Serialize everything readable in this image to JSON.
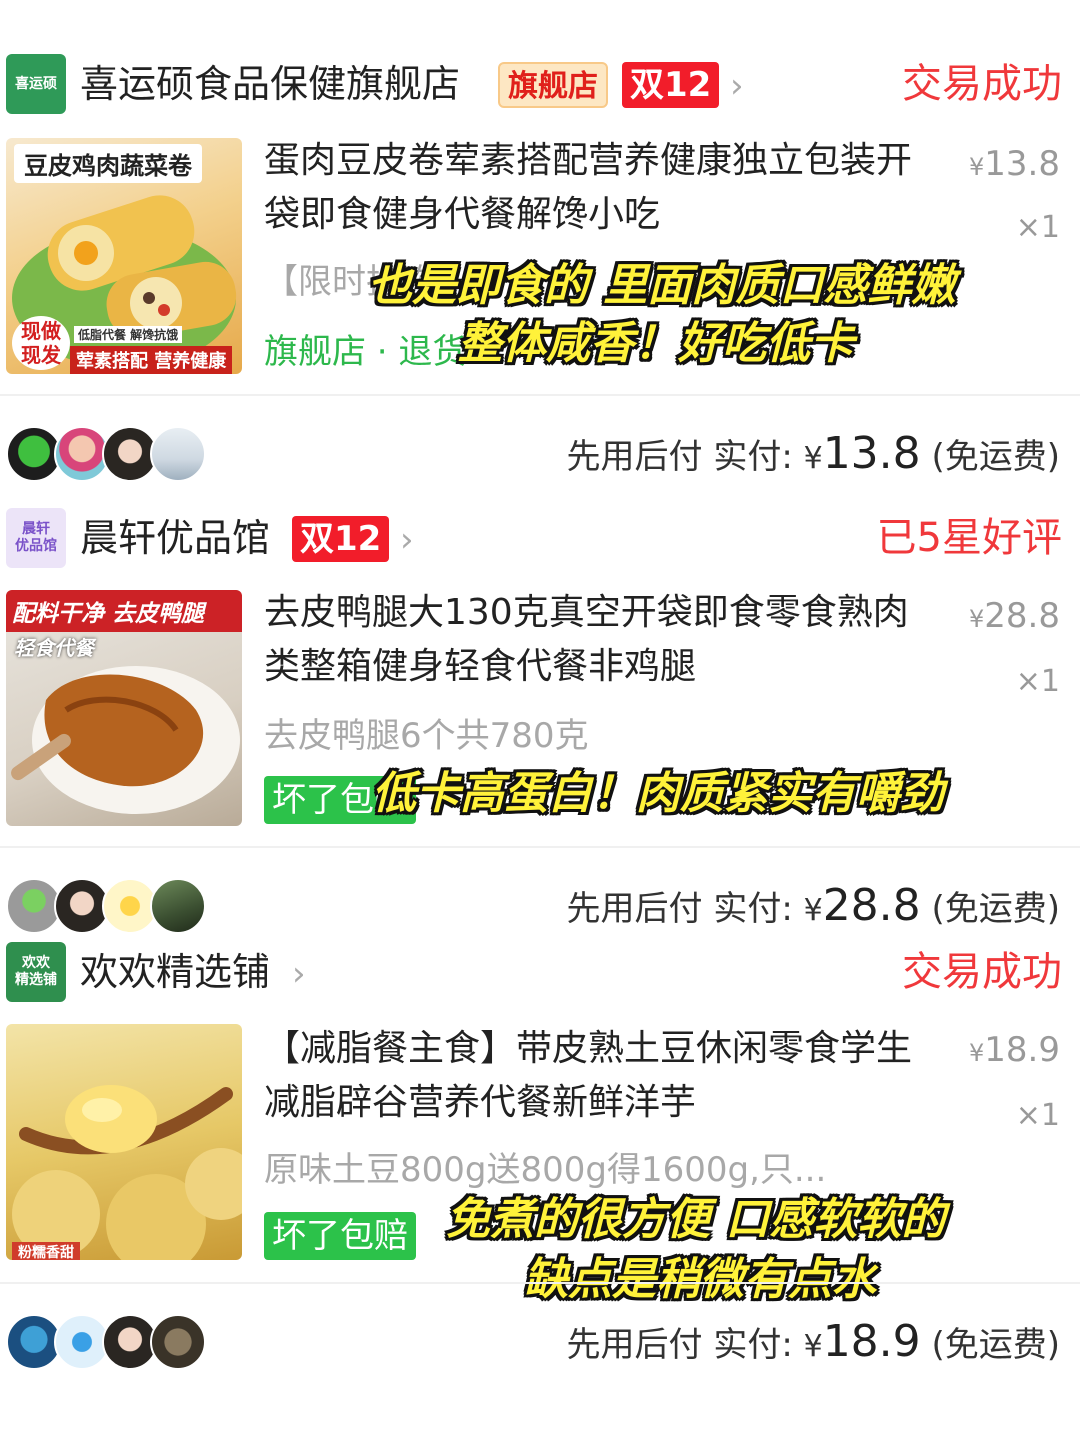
{
  "orders": [
    {
      "store": {
        "logo_text": "喜运硕",
        "name": "喜运硕食品保健旗舰店",
        "flag_badge": "旗舰店",
        "promo_badge": "双12"
      },
      "status": "交易成功",
      "product": {
        "thumb_title": "豆皮鸡肉蔬菜卷",
        "thumb_badge": "现做\n现发",
        "thumb_small": "低脂代餐 解馋抗饿",
        "thumb_caption": "荤素搭配 营养健康",
        "title": "蛋肉豆皮卷荤素搭配营养健康独立包装开袋即食健身代餐解馋小吃",
        "spec": "【限时抢购】",
        "price": "13.8",
        "qty": "×1",
        "tag": "旗舰店 · 退货"
      },
      "overlay": [
        "也是即食的 里面肉质口感鲜嫩",
        "整体咸香！好吃低卡"
      ],
      "pay": {
        "label": "先用后付 实付:",
        "currency": "¥",
        "amount": "13.8",
        "note": "(免运费)"
      }
    },
    {
      "store": {
        "logo_text": "晨轩\n优品馆",
        "name": "晨轩优品馆",
        "promo_badge": "双12"
      },
      "status": "已5星好评",
      "product": {
        "thumb_title": "配料干净 去皮鸭腿",
        "thumb_sub": "轻食代餐",
        "title": "去皮鸭腿大130克真空开袋即食零食熟肉类整箱健身轻食代餐非鸡腿",
        "spec": "去皮鸭腿6个共780克",
        "price": "28.8",
        "qty": "×1",
        "tag": "坏了包赔"
      },
      "overlay": [
        "低卡高蛋白！肉质紧实有嚼劲"
      ],
      "pay": {
        "label": "先用后付 实付:",
        "currency": "¥",
        "amount": "28.8",
        "note": "(免运费)"
      }
    },
    {
      "store": {
        "logo_text": "欢欢\n精选铺",
        "name": "欢欢精选铺"
      },
      "status": "交易成功",
      "product": {
        "thumb_caption": "粉糯香甜",
        "title": "【减脂餐主食】带皮熟土豆休闲零食学生减脂辟谷营养代餐新鲜洋芋",
        "spec": "原味土豆800g送800g得1600g,只...",
        "price": "18.9",
        "qty": "×1",
        "tag": "坏了包赔"
      },
      "overlay": [
        "免煮的很方便 口感软软的",
        "缺点是稍微有点水"
      ],
      "pay": {
        "label": "先用后付 实付:",
        "currency": "¥",
        "amount": "18.9",
        "note": "(免运费)"
      }
    }
  ],
  "colors": {
    "status_red": "#f0383b",
    "promo_red": "#f21d2a",
    "tag_green": "#2cc24a",
    "overlay_yellow": "#fff23a"
  }
}
